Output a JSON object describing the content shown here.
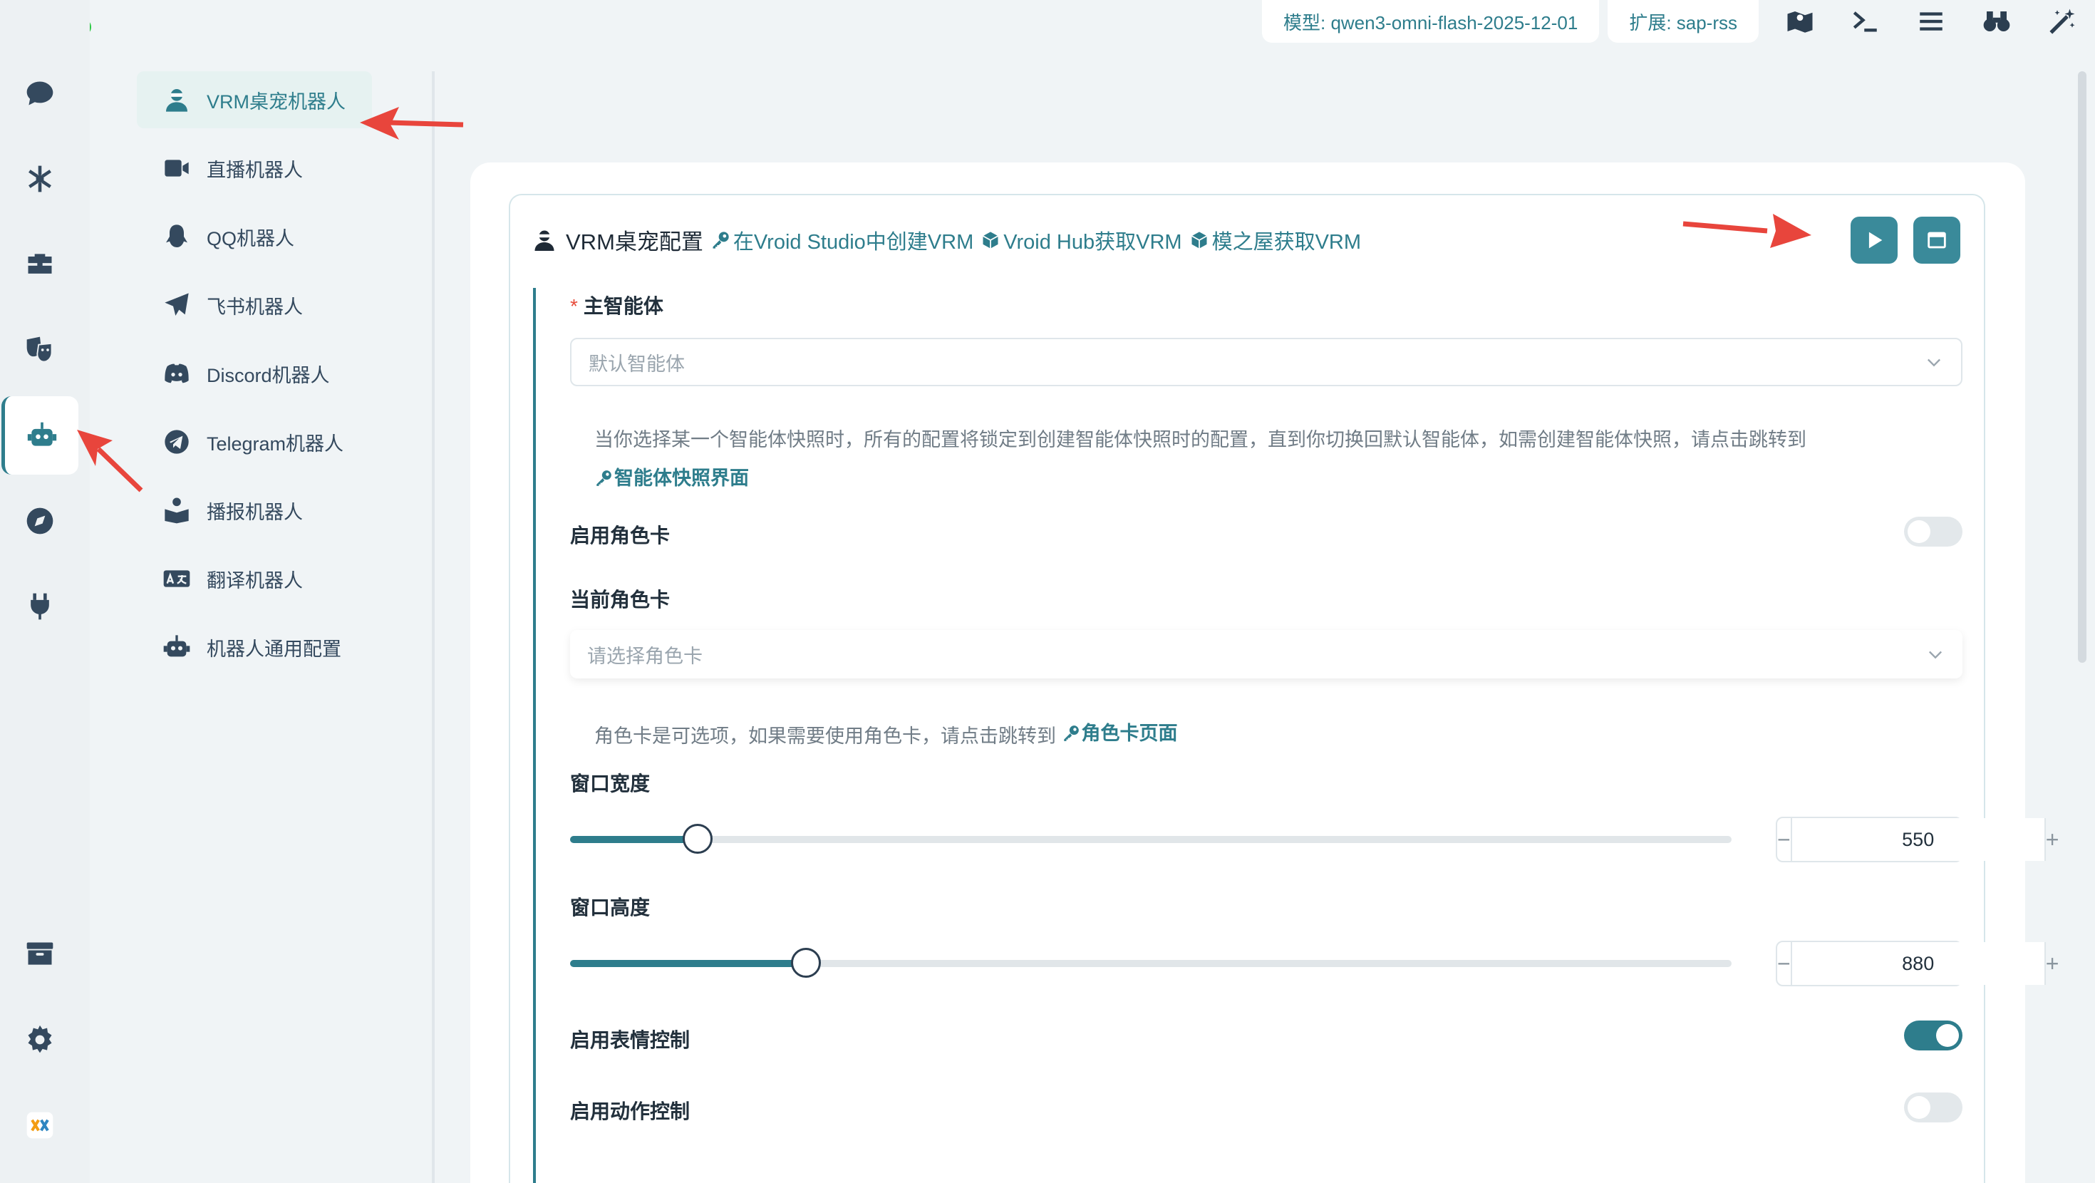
{
  "topbar": {
    "model_label": "模型: qwen3-omni-flash-2025-12-01",
    "ext_label": "扩展: sap-rss",
    "icons": [
      "map-icon",
      "terminal-icon",
      "menu-icon",
      "binoculars-icon",
      "magic-wand-icon"
    ]
  },
  "rail": {
    "items": [
      "chat-icon",
      "network-icon",
      "toolbox-icon",
      "theater-masks-icon",
      "robot-icon",
      "compass-icon",
      "plug-icon",
      "archive-icon",
      "gear-icon",
      "logo-icon"
    ],
    "active": "robot-icon"
  },
  "sub_sidebar": {
    "items": [
      {
        "label": "VRM桌宠机器人",
        "icon": "user-ninja-icon",
        "active": true
      },
      {
        "label": "直播机器人",
        "icon": "video-icon"
      },
      {
        "label": "QQ机器人",
        "icon": "penguin-icon"
      },
      {
        "label": "飞书机器人",
        "icon": "paper-plane-icon"
      },
      {
        "label": "Discord机器人",
        "icon": "discord-icon"
      },
      {
        "label": "Telegram机器人",
        "icon": "telegram-icon"
      },
      {
        "label": "播报机器人",
        "icon": "reader-icon"
      },
      {
        "label": "翻译机器人",
        "icon": "translate-icon"
      },
      {
        "label": "机器人通用配置",
        "icon": "robot-icon"
      }
    ]
  },
  "card": {
    "title": "VRM桌宠配置",
    "links": [
      "在Vroid Studio中创建VRM",
      "Vroid Hub获取VRM",
      "模之屋获取VRM"
    ]
  },
  "form": {
    "main_agent_label": "主智能体",
    "main_agent_value": "默认智能体",
    "main_agent_hint": "当你选择某一个智能体快照时，所有的配置将锁定到创建智能体快照时的配置，直到你切换回默认智能体，如需创建智能体快照，请点击跳转到",
    "main_agent_hint_link": "智能体快照界面",
    "enable_card_label": "启用角色卡",
    "enable_card": false,
    "current_card_label": "当前角色卡",
    "current_card_placeholder": "请选择角色卡",
    "card_hint": "角色卡是可选项，如果需要使用角色卡，请点击跳转到",
    "card_hint_link": "角色卡页面",
    "width_label": "窗口宽度",
    "width_value": "550",
    "width_fraction": 0.11,
    "height_label": "窗口高度",
    "height_value": "880",
    "height_fraction": 0.203,
    "expr_label": "启用表情控制",
    "expr": true,
    "motion_label": "启用动作控制",
    "motion": false
  },
  "colors": {
    "accent": "#2e7d8c",
    "arrow": "#e8453c"
  }
}
